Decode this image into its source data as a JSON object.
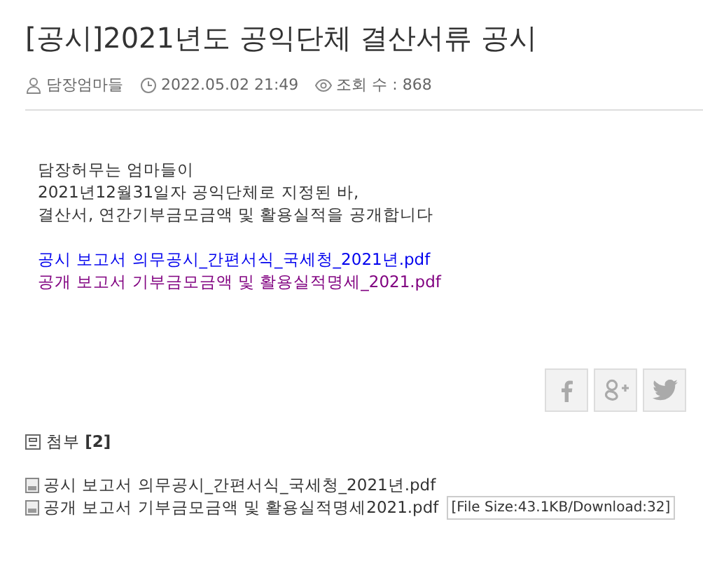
{
  "post": {
    "title": "[공시]2021년도 공익단체 결산서류 공시",
    "meta": {
      "author": "담장엄마들",
      "date": "2022.05.02 21:49",
      "views": "조회 수 : 868"
    },
    "body": [
      "담장허무는 엄마들이",
      "2021년12월31일자 공익단체로 지정된 바,",
      "결산서, 연간기부금모금액 및 활용실적을 공개합니다"
    ],
    "links": [
      {
        "text": "공시 보고서 의무공시_간편서식_국세청_2021년.pdf",
        "visited": false
      },
      {
        "text": "공개 보고서 기부금모금액 및 활용실적명세_2021.pdf",
        "visited": true
      }
    ],
    "share": [
      {
        "kind": "facebook"
      },
      {
        "kind": "google-plus"
      },
      {
        "kind": "twitter"
      }
    ],
    "attachments": {
      "label": "첨부",
      "count": "[2]",
      "files": [
        {
          "name": "공시 보고서 의무공시_간편서식_국세청_2021년.pdf"
        },
        {
          "name": "공개 보고서 기부금모금액 및 활용실적명세2021.pdf",
          "tooltip": "[File Size:43.1KB/Download:32]"
        }
      ]
    }
  }
}
